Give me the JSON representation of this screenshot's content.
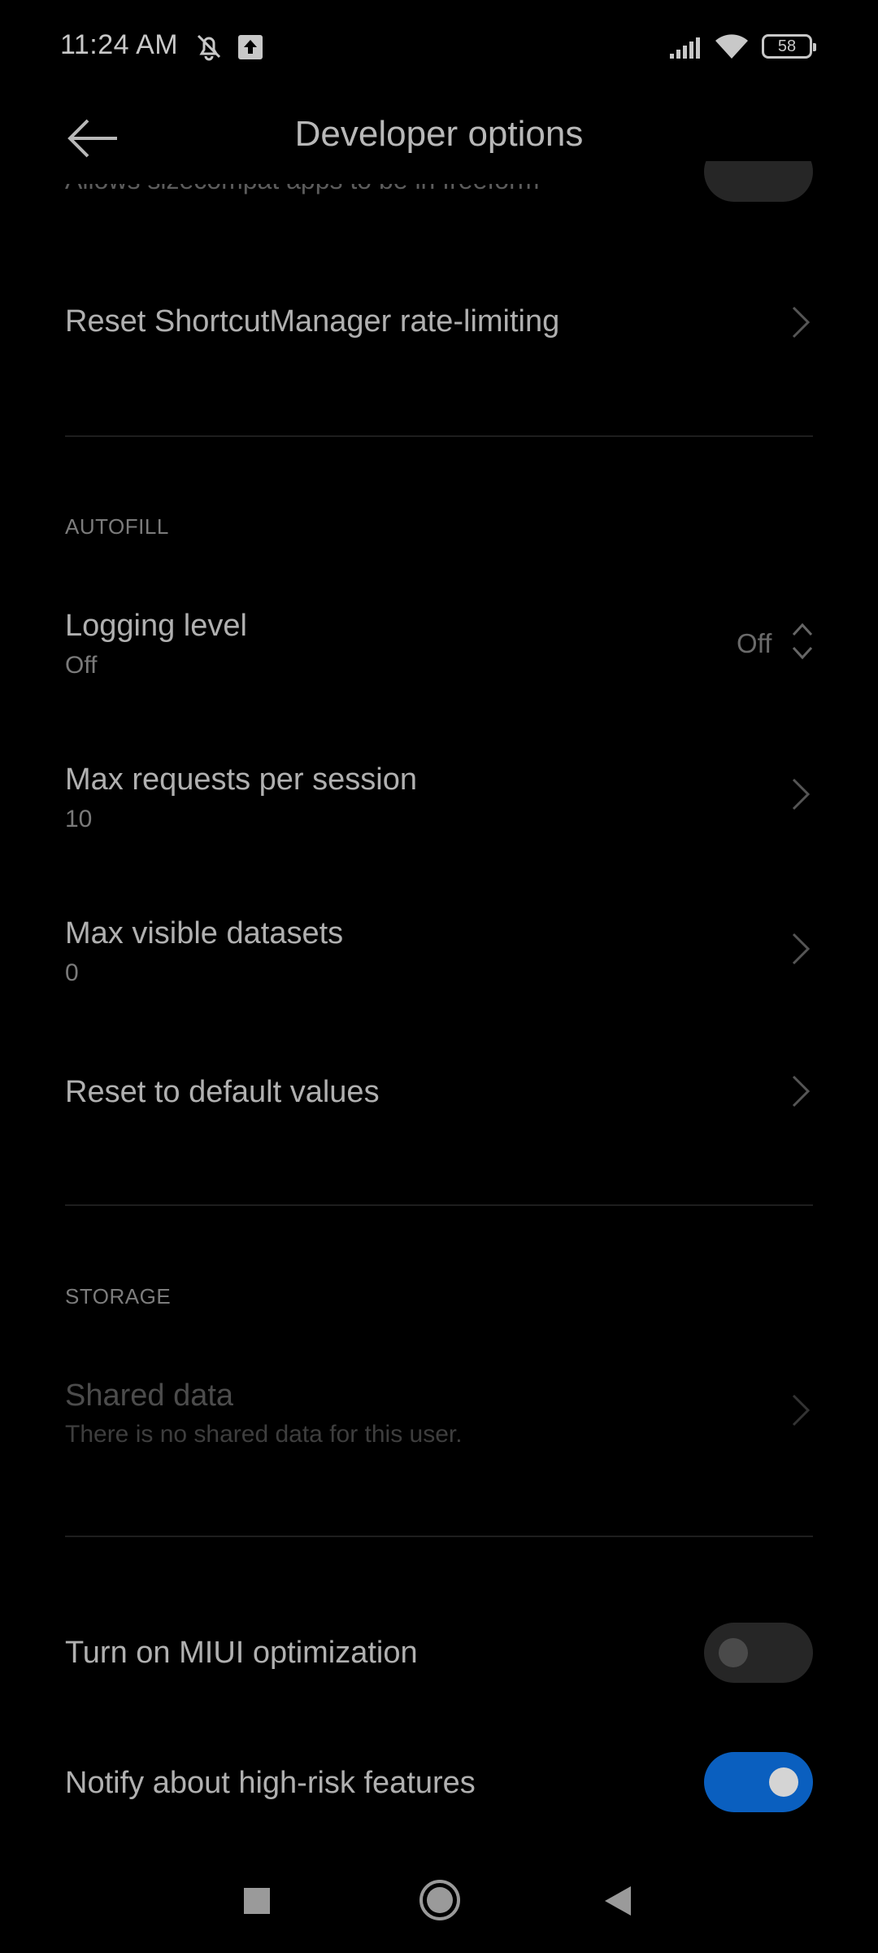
{
  "status_bar": {
    "time": "11:24 AM",
    "battery": "58",
    "icons": [
      "alarm-off-icon",
      "upload-icon",
      "signal-icon",
      "wifi-icon",
      "battery-icon"
    ]
  },
  "header": {
    "title": "Developer options",
    "back_icon": "arrow-left-icon"
  },
  "partial_row": {
    "subtitle": "Allows sizecompat apps to be in freeform"
  },
  "rows": {
    "reset_shortcut": {
      "title": "Reset ShortcutManager rate-limiting"
    },
    "logging_level": {
      "title": "Logging level",
      "subtitle": "Off",
      "value": "Off"
    },
    "max_requests": {
      "title": "Max requests per session",
      "subtitle": "10"
    },
    "max_visible": {
      "title": "Max visible datasets",
      "subtitle": "0"
    },
    "reset_default": {
      "title": "Reset to default values"
    },
    "shared_data": {
      "title": "Shared data",
      "subtitle": "There is no shared data for this user."
    },
    "miui_optimization": {
      "title": "Turn on MIUI optimization",
      "enabled": false
    },
    "notify_high_risk": {
      "title": "Notify about high-risk features",
      "enabled": true
    }
  },
  "sections": {
    "autofill": "AUTOFILL",
    "storage": "STORAGE"
  },
  "nav_bar": {
    "icons": [
      "recents-square-icon",
      "home-circle-icon",
      "back-triangle-icon"
    ]
  },
  "colors": {
    "background": "#000000",
    "accent": "#0a5fbf"
  }
}
